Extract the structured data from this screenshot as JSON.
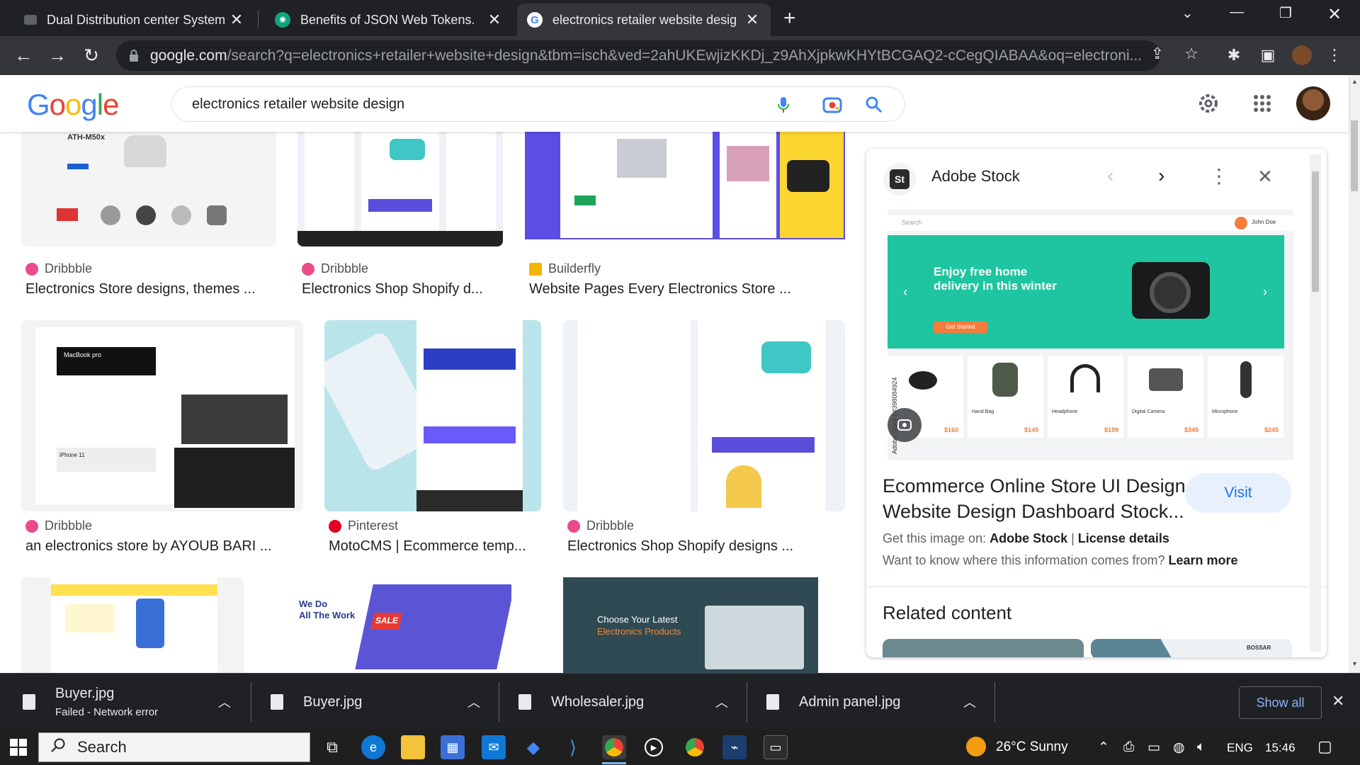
{
  "browser": {
    "tabs": [
      {
        "title": "Dual Distribution center System",
        "active": false
      },
      {
        "title": "Benefits of JSON Web Tokens.",
        "active": false
      },
      {
        "title": "electronics retailer website desig",
        "active": true
      }
    ],
    "url_host": "google.com",
    "url_path": "/search?q=electronics+retailer+website+design&tbm=isch&ved=2ahUKEwjizKKDj_z9AhXjpkwKHYtBCGAQ2-cCegQIABAA&oq=electroni..."
  },
  "google": {
    "logo": "Google",
    "query": "electronics retailer website design"
  },
  "results": [
    {
      "source": "Dribbble",
      "title": "Electronics Store designs, themes ...",
      "fav_color": "#ea4c89"
    },
    {
      "source": "Dribbble",
      "title": "Electronics Shop Shopify d...",
      "fav_color": "#ea4c89"
    },
    {
      "source": "Builderfly",
      "title": "Website Pages Every Electronics Store ...",
      "fav_color": "#f4b400"
    },
    {
      "source": "Dribbble",
      "title": "an electronics store by AYOUB BARI ...",
      "fav_color": "#ea4c89"
    },
    {
      "source": "Pinterest",
      "title": "MotoCMS | Ecommerce temp...",
      "fav_color": "#e60023"
    },
    {
      "source": "Dribbble",
      "title": "Electronics Shop Shopify designs ...",
      "fav_color": "#ea4c89"
    }
  ],
  "thumb_text": {
    "ath": "ATH-M50x",
    "macbook": "MacBook pro",
    "iphone": "iPhone 11",
    "wedo": "We Do",
    "allwork": "All The Work",
    "sale": "SALE",
    "choose": "Choose Your Latest",
    "choose2": "Electronics Products"
  },
  "panel": {
    "source": "Adobe Stock",
    "image_banner_title": "Enjoy free home delivery in this winter",
    "image_cta": "Get Started",
    "image_user": "John Doe",
    "image_search": "Search",
    "image_id": "Adobe Stock | #398084924",
    "products": [
      {
        "name": "Hand Bag",
        "price": "$160"
      },
      {
        "name": "Hand Bag",
        "price": "$149"
      },
      {
        "name": "Headphone",
        "price": "$199"
      },
      {
        "name": "Digital Camera",
        "price": "$349"
      },
      {
        "name": "Microphone",
        "price": "$245"
      }
    ],
    "title": "Ecommerce Online Store UI Design Website Design Dashboard Stock...",
    "visit_label": "Visit",
    "get_image_prefix": "Get this image on:",
    "get_image_source": "Adobe Stock",
    "license_label": "License details",
    "where_info": "Want to know where this information comes from?",
    "learn_more": "Learn more",
    "related": "Related content",
    "related_thumb_text": "BOSSAR"
  },
  "downloads": [
    {
      "name": "Buyer.jpg",
      "status": "Failed - Network error"
    },
    {
      "name": "Buyer.jpg",
      "status": ""
    },
    {
      "name": "Wholesaler.jpg",
      "status": ""
    },
    {
      "name": "Admin panel.jpg",
      "status": ""
    }
  ],
  "show_all": "Show all",
  "taskbar": {
    "search": "Search",
    "weather": "26°C  Sunny",
    "lang": "ENG",
    "time": "15:46"
  }
}
